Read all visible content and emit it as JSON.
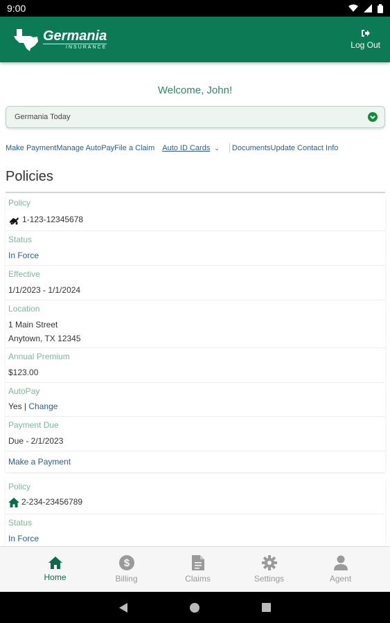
{
  "status_bar": {
    "time": "9:00"
  },
  "header": {
    "logo_name": "Germania",
    "logo_sub": "INSURANCE",
    "logout_label": "Log Out"
  },
  "welcome": "Welcome, John!",
  "news_select": {
    "selected": "Germania Today"
  },
  "quick_links": {
    "make_payment": "Make Payment",
    "manage_autopay": "Manage AutoPay",
    "file_claim": "File a Claim",
    "auto_id_cards": "Auto ID Cards",
    "documents": "Documents",
    "update_contact": "Update Contact Info"
  },
  "policies_title": "Policies",
  "policies": [
    {
      "policy_label": "Policy",
      "policy_number": "1-123-12345678",
      "policy_icon": "car-crash-icon",
      "status_label": "Status",
      "status": "In Force",
      "effective_label": "Effective",
      "effective": "1/1/2023 - 1/1/2024",
      "location_label": "Location",
      "location_line1": "1 Main Street",
      "location_line2": "Anytown, TX 12345",
      "premium_label": "Annual Premium",
      "premium": "$123.00",
      "autopay_label": "AutoPay",
      "autopay_value": "Yes",
      "autopay_sep": " | ",
      "autopay_change": "Change",
      "due_label": "Payment Due",
      "due": "Due - 2/1/2023",
      "pay_link": "Make a Payment"
    },
    {
      "policy_label": "Policy",
      "policy_number": "2-234-23456789",
      "policy_icon": "home-icon",
      "status_label": "Status",
      "status": "In Force"
    }
  ],
  "bottom_nav": [
    {
      "label": "Home",
      "icon": "home-icon",
      "active": true
    },
    {
      "label": "Billing",
      "icon": "dollar-icon",
      "active": false
    },
    {
      "label": "Claims",
      "icon": "document-icon",
      "active": false
    },
    {
      "label": "Settings",
      "icon": "gear-icon",
      "active": false
    },
    {
      "label": "Agent",
      "icon": "person-icon",
      "active": false
    }
  ],
  "colors": {
    "brand": "#0b7a55",
    "label": "#7fb69c",
    "link": "#2a5d8f",
    "welcome": "#2e8b64"
  }
}
